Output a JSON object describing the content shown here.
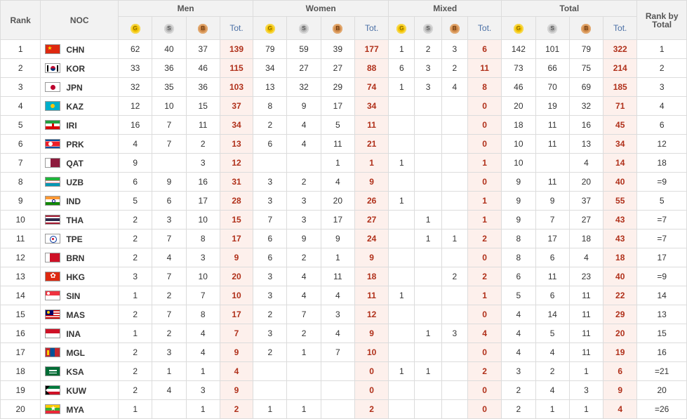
{
  "header": {
    "rank": "Rank",
    "noc": "NOC",
    "men": "Men",
    "women": "Women",
    "mixed": "Mixed",
    "total": "Total",
    "rank_by_total": "Rank by Total",
    "tot": "Tot.",
    "medal_icons": [
      "gold-medal-icon",
      "silver-medal-icon",
      "bronze-medal-icon"
    ]
  },
  "colors": {
    "total_cell_bg": "#fdf0ec",
    "total_text": "#b0301a",
    "header_bg": "#f2f2f2"
  },
  "rows": [
    {
      "rank": "1",
      "code": "CHN",
      "flag": "china",
      "men": [
        "62",
        "40",
        "37",
        "139"
      ],
      "women": [
        "79",
        "59",
        "39",
        "177"
      ],
      "mixed": [
        "1",
        "2",
        "3",
        "6"
      ],
      "total": [
        "142",
        "101",
        "79",
        "322"
      ],
      "rbt": "1"
    },
    {
      "rank": "2",
      "code": "KOR",
      "flag": "korea",
      "men": [
        "33",
        "36",
        "46",
        "115"
      ],
      "women": [
        "34",
        "27",
        "27",
        "88"
      ],
      "mixed": [
        "6",
        "3",
        "2",
        "11"
      ],
      "total": [
        "73",
        "66",
        "75",
        "214"
      ],
      "rbt": "2"
    },
    {
      "rank": "3",
      "code": "JPN",
      "flag": "japan",
      "men": [
        "32",
        "35",
        "36",
        "103"
      ],
      "women": [
        "13",
        "32",
        "29",
        "74"
      ],
      "mixed": [
        "1",
        "3",
        "4",
        "8"
      ],
      "total": [
        "46",
        "70",
        "69",
        "185"
      ],
      "rbt": "3"
    },
    {
      "rank": "4",
      "code": "KAZ",
      "flag": "kazakhstan",
      "men": [
        "12",
        "10",
        "15",
        "37"
      ],
      "women": [
        "8",
        "9",
        "17",
        "34"
      ],
      "mixed": [
        "",
        "",
        "",
        "0"
      ],
      "total": [
        "20",
        "19",
        "32",
        "71"
      ],
      "rbt": "4"
    },
    {
      "rank": "5",
      "code": "IRI",
      "flag": "iran",
      "men": [
        "16",
        "7",
        "11",
        "34"
      ],
      "women": [
        "2",
        "4",
        "5",
        "11"
      ],
      "mixed": [
        "",
        "",
        "",
        "0"
      ],
      "total": [
        "18",
        "11",
        "16",
        "45"
      ],
      "rbt": "6"
    },
    {
      "rank": "6",
      "code": "PRK",
      "flag": "north-korea",
      "men": [
        "4",
        "7",
        "2",
        "13"
      ],
      "women": [
        "6",
        "4",
        "11",
        "21"
      ],
      "mixed": [
        "",
        "",
        "",
        "0"
      ],
      "total": [
        "10",
        "11",
        "13",
        "34"
      ],
      "rbt": "12"
    },
    {
      "rank": "7",
      "code": "QAT",
      "flag": "qatar",
      "men": [
        "9",
        "",
        "3",
        "12"
      ],
      "women": [
        "",
        "",
        "1",
        "1"
      ],
      "mixed": [
        "1",
        "",
        "",
        "1"
      ],
      "total": [
        "10",
        "",
        "4",
        "14"
      ],
      "rbt": "18"
    },
    {
      "rank": "8",
      "code": "UZB",
      "flag": "uzbekistan",
      "men": [
        "6",
        "9",
        "16",
        "31"
      ],
      "women": [
        "3",
        "2",
        "4",
        "9"
      ],
      "mixed": [
        "",
        "",
        "",
        "0"
      ],
      "total": [
        "9",
        "11",
        "20",
        "40"
      ],
      "rbt": "=9"
    },
    {
      "rank": "9",
      "code": "IND",
      "flag": "india",
      "men": [
        "5",
        "6",
        "17",
        "28"
      ],
      "women": [
        "3",
        "3",
        "20",
        "26"
      ],
      "mixed": [
        "1",
        "",
        "",
        "1"
      ],
      "total": [
        "9",
        "9",
        "37",
        "55"
      ],
      "rbt": "5"
    },
    {
      "rank": "10",
      "code": "THA",
      "flag": "thailand",
      "men": [
        "2",
        "3",
        "10",
        "15"
      ],
      "women": [
        "7",
        "3",
        "17",
        "27"
      ],
      "mixed": [
        "",
        "1",
        "",
        "1"
      ],
      "total": [
        "9",
        "7",
        "27",
        "43"
      ],
      "rbt": "=7"
    },
    {
      "rank": "11",
      "code": "TPE",
      "flag": "chinese-taipei",
      "men": [
        "2",
        "7",
        "8",
        "17"
      ],
      "women": [
        "6",
        "9",
        "9",
        "24"
      ],
      "mixed": [
        "",
        "1",
        "1",
        "2"
      ],
      "total": [
        "8",
        "17",
        "18",
        "43"
      ],
      "rbt": "=7"
    },
    {
      "rank": "12",
      "code": "BRN",
      "flag": "bahrain",
      "men": [
        "2",
        "4",
        "3",
        "9"
      ],
      "women": [
        "6",
        "2",
        "1",
        "9"
      ],
      "mixed": [
        "",
        "",
        "",
        "0"
      ],
      "total": [
        "8",
        "6",
        "4",
        "18"
      ],
      "rbt": "17"
    },
    {
      "rank": "13",
      "code": "HKG",
      "flag": "hong-kong",
      "men": [
        "3",
        "7",
        "10",
        "20"
      ],
      "women": [
        "3",
        "4",
        "11",
        "18"
      ],
      "mixed": [
        "",
        "",
        "2",
        "2"
      ],
      "total": [
        "6",
        "11",
        "23",
        "40"
      ],
      "rbt": "=9"
    },
    {
      "rank": "14",
      "code": "SIN",
      "flag": "singapore",
      "men": [
        "1",
        "2",
        "7",
        "10"
      ],
      "women": [
        "3",
        "4",
        "4",
        "11"
      ],
      "mixed": [
        "1",
        "",
        "",
        "1"
      ],
      "total": [
        "5",
        "6",
        "11",
        "22"
      ],
      "rbt": "14"
    },
    {
      "rank": "15",
      "code": "MAS",
      "flag": "malaysia",
      "men": [
        "2",
        "7",
        "8",
        "17"
      ],
      "women": [
        "2",
        "7",
        "3",
        "12"
      ],
      "mixed": [
        "",
        "",
        "",
        "0"
      ],
      "total": [
        "4",
        "14",
        "11",
        "29"
      ],
      "rbt": "13"
    },
    {
      "rank": "16",
      "code": "INA",
      "flag": "indonesia",
      "men": [
        "1",
        "2",
        "4",
        "7"
      ],
      "women": [
        "3",
        "2",
        "4",
        "9"
      ],
      "mixed": [
        "",
        "1",
        "3",
        "4"
      ],
      "total": [
        "4",
        "5",
        "11",
        "20"
      ],
      "rbt": "15"
    },
    {
      "rank": "17",
      "code": "MGL",
      "flag": "mongolia",
      "men": [
        "2",
        "3",
        "4",
        "9"
      ],
      "women": [
        "2",
        "1",
        "7",
        "10"
      ],
      "mixed": [
        "",
        "",
        "",
        "0"
      ],
      "total": [
        "4",
        "4",
        "11",
        "19"
      ],
      "rbt": "16"
    },
    {
      "rank": "18",
      "code": "KSA",
      "flag": "saudi-arabia",
      "men": [
        "2",
        "1",
        "1",
        "4"
      ],
      "women": [
        "",
        "",
        "",
        "0"
      ],
      "mixed": [
        "1",
        "1",
        "",
        "2"
      ],
      "total": [
        "3",
        "2",
        "1",
        "6"
      ],
      "rbt": "=21"
    },
    {
      "rank": "19",
      "code": "KUW",
      "flag": "kuwait",
      "men": [
        "2",
        "4",
        "3",
        "9"
      ],
      "women": [
        "",
        "",
        "",
        "0"
      ],
      "mixed": [
        "",
        "",
        "",
        "0"
      ],
      "total": [
        "2",
        "4",
        "3",
        "9"
      ],
      "rbt": "20"
    },
    {
      "rank": "20",
      "code": "MYA",
      "flag": "myanmar",
      "men": [
        "1",
        "",
        "1",
        "2"
      ],
      "women": [
        "1",
        "1",
        "",
        "2"
      ],
      "mixed": [
        "",
        "",
        "",
        "0"
      ],
      "total": [
        "2",
        "1",
        "1",
        "4"
      ],
      "rbt": "=26"
    }
  ]
}
